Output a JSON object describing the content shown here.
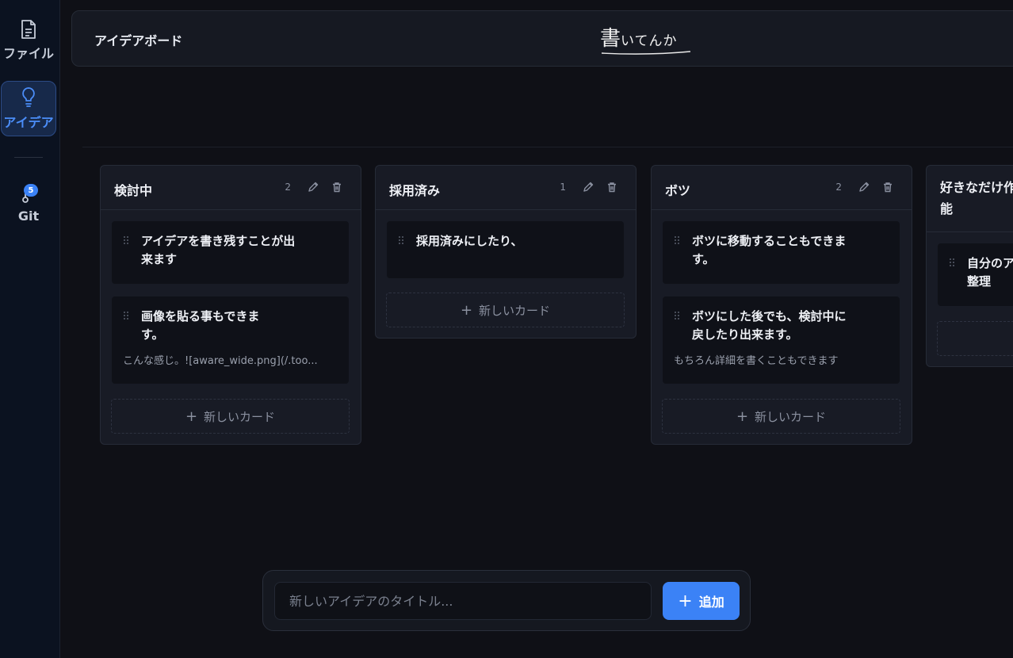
{
  "sidebar": {
    "items": [
      {
        "label": "ファイル",
        "icon": "file-icon"
      },
      {
        "label": "アイデア",
        "icon": "lightbulb-icon"
      },
      {
        "label": "Git",
        "icon": "git-icon",
        "badge": "5"
      }
    ]
  },
  "header": {
    "title": "アイデアボード",
    "logo_main": "書",
    "logo_rest": "いてんか"
  },
  "columns": [
    {
      "title": "検討中",
      "count": "2",
      "cards": [
        {
          "title": "アイデアを書き残すことが出来ます",
          "desc": ""
        },
        {
          "title": "画像を貼る事もできます。",
          "desc": "こんな感じ。![aware_wide.png](/.too..."
        }
      ],
      "add_label": "新しいカード"
    },
    {
      "title": "採用済み",
      "count": "1",
      "cards": [
        {
          "title": "採用済みにしたり、",
          "desc": ""
        }
      ],
      "add_label": "新しいカード"
    },
    {
      "title": "ボツ",
      "count": "2",
      "cards": [
        {
          "title": "ボツに移動することもできます。",
          "desc": ""
        },
        {
          "title": "ボツにした後でも、検討中に戻したり出来ます。",
          "desc": "もちろん詳細を書くこともできます"
        }
      ],
      "add_label": "新しいカード"
    },
    {
      "title": "好きなだけ作成も可能",
      "cards": [
        {
          "title": "自分のアイデアを好きな形で整理",
          "desc": ""
        }
      ]
    }
  ],
  "input": {
    "placeholder": "新しいアイデアのタイトル...",
    "add_label": "追加"
  },
  "colors": {
    "accent": "#3b82f6",
    "background": "#0f1016",
    "sidebar": "#0b1220",
    "column": "#181b25",
    "card": "#0f1118"
  }
}
